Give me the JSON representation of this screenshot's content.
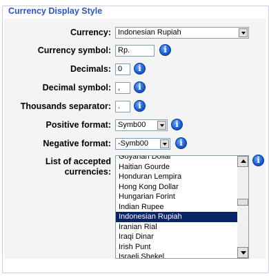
{
  "legend": "Currency Display Style",
  "currency": {
    "label": "Currency:",
    "value": "Indonesian Rupiah"
  },
  "symbol": {
    "label": "Currency symbol:",
    "value": "Rp."
  },
  "decimals": {
    "label": "Decimals:",
    "value": "0"
  },
  "decimal_symbol": {
    "label": "Decimal symbol:",
    "value": ","
  },
  "thousands_separator": {
    "label": "Thousands separator:",
    "value": "."
  },
  "positive_format": {
    "label": "Positive format:",
    "value": "Symb00"
  },
  "negative_format": {
    "label": "Negative format:",
    "value": "-Symb00"
  },
  "accepted": {
    "label_line1": "List of accepted",
    "label_line2": "currencies:",
    "items": [
      "Guyanan Dollar",
      "Haitian Gourde",
      "Honduran Lempira",
      "Hong Kong Dollar",
      "Hungarian Forint",
      "Indian Rupee",
      "Indonesian Rupiah",
      "Iranian Rial",
      "Iraqi Dinar",
      "Irish Punt",
      "Israeli Shekel"
    ],
    "selected": "Indonesian Rupiah"
  },
  "info_icon_glyph": "i",
  "colors": {
    "legend": "#2a56c6",
    "selection": "#0a246a",
    "info": "#1d5fd6"
  }
}
